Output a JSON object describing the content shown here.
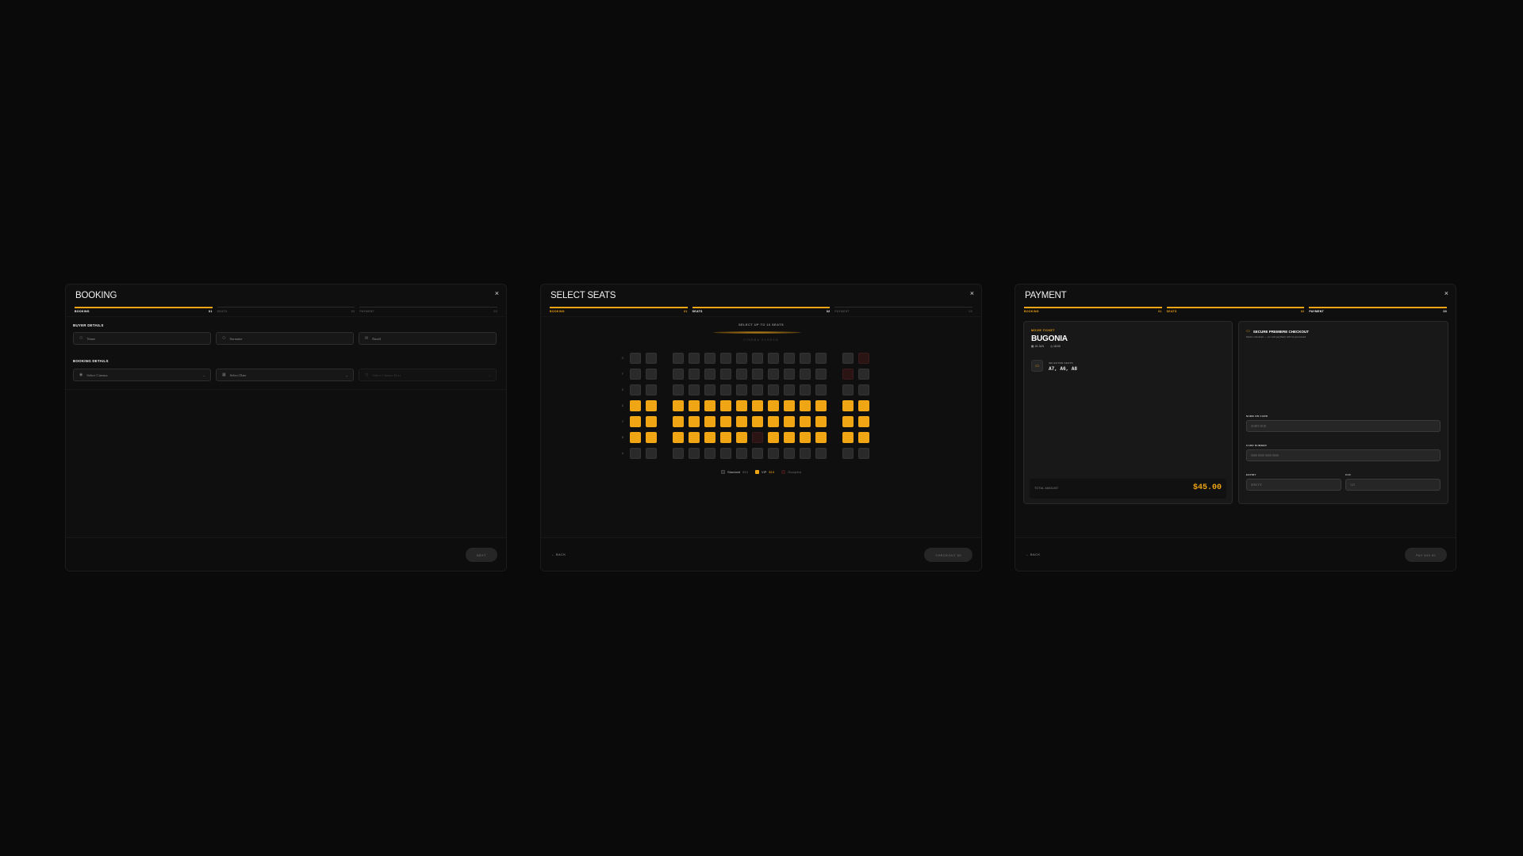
{
  "booking": {
    "title": "BOOKING",
    "close": "×",
    "steps": [
      {
        "label": "BOOKING",
        "num": "01"
      },
      {
        "label": "SEATS",
        "num": "02"
      },
      {
        "label": "PAYMENT",
        "num": "03"
      }
    ],
    "buyer_label": "BUYER DETAILS",
    "name_placeholder": "Name",
    "surname_placeholder": "Surname",
    "email_placeholder": "Email",
    "booking_label": "BOOKING DETAILS",
    "cinema_placeholder": "Select Cinema",
    "date_placeholder": "Select Date",
    "time_placeholder": "Select Cinema First",
    "next_label": "NEXT"
  },
  "seats": {
    "title": "SELECT SEATS",
    "close": "×",
    "steps": [
      {
        "label": "BOOKING",
        "num": "01"
      },
      {
        "label": "SEATS",
        "num": "02"
      },
      {
        "label": "PAYMENT",
        "num": "03"
      }
    ],
    "hint": "SELECT UP TO 10 SEATS",
    "screen_label": "CINEMA SCREEN",
    "rows": [
      "G",
      "F",
      "E",
      "D",
      "C",
      "B",
      "A"
    ],
    "layout": [
      "SS.SSSSSSSSSS.SO",
      "SS.SSSSSSSSSS.OS",
      "SS.SSSSSSSSSS.SS",
      "VV.VVVVVVVVVV.VV",
      "VV.VVVVVVVVVV.VV",
      "VV.VVVVVOVVVV.VV",
      "SS.SSSSSSSSSS.SS"
    ],
    "legend": {
      "standard": "Standard",
      "standard_price": "$10",
      "vip": "VIP",
      "vip_price": "$15",
      "occupied": "Occupied"
    },
    "colors": {
      "vip": "#f0a514",
      "standard": "#2a2a2a",
      "occupied": "#2a1414"
    },
    "back_label": "BACK",
    "checkout_label": "CHECKOUT $0"
  },
  "payment": {
    "title": "PAYMENT",
    "close": "×",
    "steps": [
      {
        "label": "BOOKING",
        "num": "01"
      },
      {
        "label": "SEATS",
        "num": "02"
      },
      {
        "label": "PAYMENT",
        "num": "03"
      }
    ],
    "ticket": {
      "kicker": "MOVIE TICKET",
      "movie": "BUGONIA",
      "date": "15 JUN",
      "time": "18:00",
      "seats_label": "SELECTED SEATS",
      "seats_value": "A7, A6, A8",
      "total_label": "TOTAL AMOUNT",
      "total_value": "$45.00"
    },
    "checkout": {
      "title": "SECURE PREMIERE CHECKOUT",
      "subtitle": "Demo checkout — no real payment will be processed",
      "name_label": "NAME ON CARD",
      "name_placeholder": "JOHN DOE",
      "card_label": "CARD NUMBER",
      "card_placeholder": "0000 0000 0000 0000",
      "expiry_label": "EXPIRY",
      "expiry_placeholder": "MM/YY",
      "cvc_label": "CVC",
      "cvc_placeholder": "123"
    },
    "back_label": "BACK",
    "pay_label": "PAY $45.00"
  }
}
